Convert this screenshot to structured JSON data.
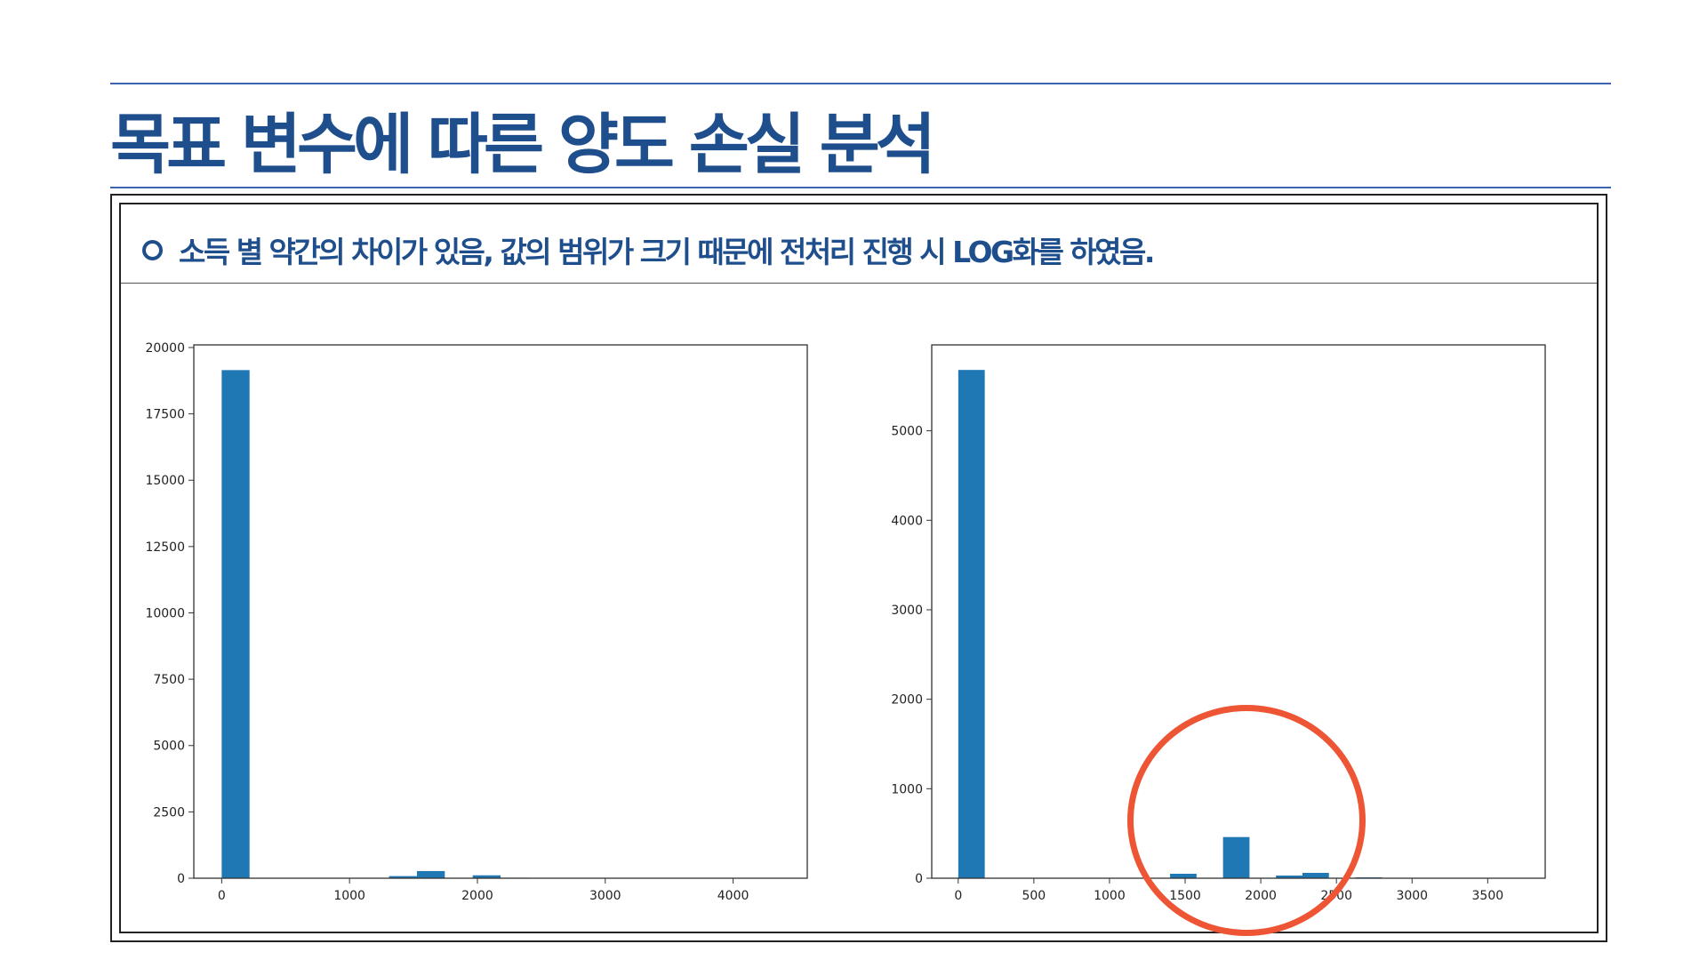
{
  "slide": {
    "title": "목표 변수에 따른 양도 손실 분석",
    "bullet_text": "소득 별 약간의 차이가 있음, 값의 범위가 크기 때문에 전처리 진행 시 LOG화를 하였음.",
    "accent_color": "#1f4e8c",
    "annotation_color": "#ee5534",
    "bar_color": "#1f77b4"
  },
  "chart_data": [
    {
      "type": "bar",
      "bin_width": 218,
      "x": [
        109,
        1418,
        1636,
        2072,
        2290
      ],
      "values": [
        19150,
        80,
        270,
        110,
        20
      ],
      "xlim": [
        -218,
        4580
      ],
      "ylim": [
        0,
        20100
      ],
      "xticks": [
        0,
        1000,
        2000,
        3000,
        4000
      ],
      "yticks": [
        0,
        2500,
        5000,
        7500,
        10000,
        12500,
        15000,
        17500,
        20000
      ],
      "title": "",
      "xlabel": "",
      "ylabel": ""
    },
    {
      "type": "bar",
      "bin_width": 175,
      "x": [
        88,
        1488,
        1838,
        2188,
        2363,
        2713
      ],
      "values": [
        5680,
        50,
        460,
        30,
        60,
        10
      ],
      "xlim": [
        -175,
        3880
      ],
      "ylim": [
        0,
        5960
      ],
      "xticks": [
        0,
        500,
        1000,
        1500,
        2000,
        2500,
        3000,
        3500
      ],
      "yticks": [
        0,
        1000,
        2000,
        3000,
        4000,
        5000
      ],
      "title": "",
      "xlabel": "",
      "ylabel": ""
    }
  ]
}
